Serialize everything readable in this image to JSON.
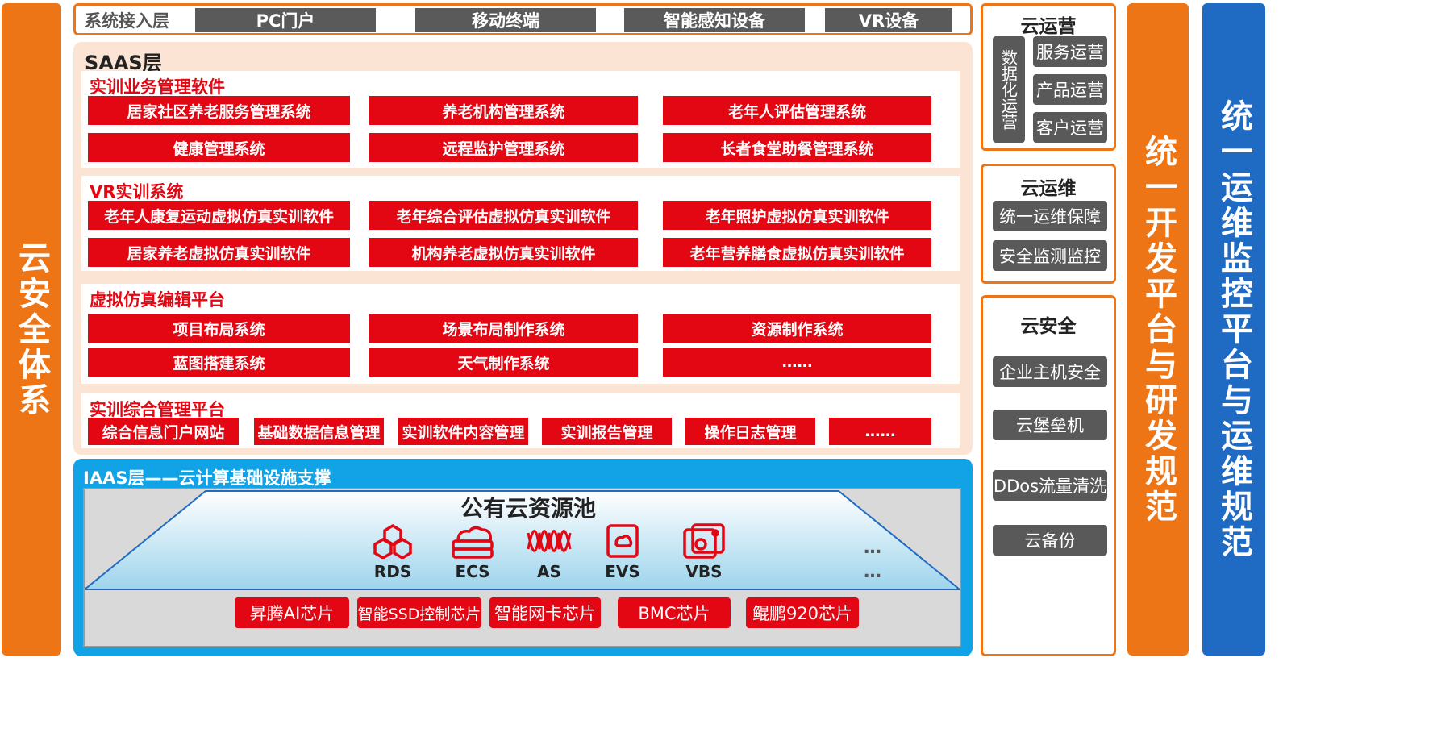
{
  "left_bar": "云安全体系",
  "right_bar_1": "统一开发平台与研发规范",
  "right_bar_2": "统一运维监控平台与运维规范",
  "access_layer": {
    "title": "系统接入层",
    "items": [
      "PC门户",
      "移动终端",
      "智能感知设备",
      "VR设备"
    ]
  },
  "saas": {
    "title": "SAAS层",
    "sections": [
      {
        "title": "实训业务管理软件",
        "rows": [
          [
            "居家社区养老服务管理系统",
            "养老机构管理系统",
            "老年人评估管理系统"
          ],
          [
            "健康管理系统",
            "远程监护管理系统",
            "长者食堂助餐管理系统"
          ]
        ]
      },
      {
        "title": "VR实训系统",
        "rows": [
          [
            "老年人康复运动虚拟仿真实训软件",
            "老年综合评估虚拟仿真实训软件",
            "老年照护虚拟仿真实训软件"
          ],
          [
            "居家养老虚拟仿真实训软件",
            "机构养老虚拟仿真实训软件",
            "老年营养膳食虚拟仿真实训软件"
          ]
        ]
      },
      {
        "title": "虚拟仿真编辑平台",
        "rows": [
          [
            "项目布局系统",
            "场景布局制作系统",
            "资源制作系统"
          ],
          [
            "蓝图搭建系统",
            "天气制作系统",
            "……"
          ]
        ]
      }
    ],
    "mgmt": {
      "title": "实训综合管理平台",
      "items": [
        "综合信息门户网站",
        "基础数据信息管理",
        "实训软件内容管理",
        "实训报告管理",
        "操作日志管理",
        "……"
      ]
    }
  },
  "iaas": {
    "title": "IAAS层——云计算基础设施支撑",
    "pool_title": "公有云资源池",
    "services": [
      {
        "label": "RDS",
        "icon": "hexagon-cluster-icon"
      },
      {
        "label": "ECS",
        "icon": "server-cloud-icon"
      },
      {
        "label": "AS",
        "icon": "auto-scaling-icon"
      },
      {
        "label": "EVS",
        "icon": "storage-disk-icon"
      },
      {
        "label": "VBS",
        "icon": "backup-disk-icon"
      }
    ],
    "ellipsis_1": "…",
    "ellipsis_2": "…",
    "chips": [
      "昇腾AI芯片",
      "智能SSD控制芯片",
      "智能网卡芯片",
      "BMC芯片",
      "鲲鹏920芯片"
    ]
  },
  "cloud_ops": {
    "title": "云运营",
    "vertical_label": "数据化运营",
    "items": [
      "服务运营",
      "产品运营",
      "客户运营"
    ]
  },
  "cloud_maint": {
    "title": "云运维",
    "items": [
      "统一运维保障",
      "安全监测监控"
    ]
  },
  "cloud_sec": {
    "title": "云安全",
    "items": [
      "企业主机安全",
      "云堡垒机",
      "DDos流量清洗",
      "云备份"
    ]
  },
  "colors": {
    "orange": "#ee7516",
    "red": "#e30613",
    "blue": "#1f6bc4",
    "sky": "#12a3e6",
    "gray": "#5a5a5a"
  }
}
